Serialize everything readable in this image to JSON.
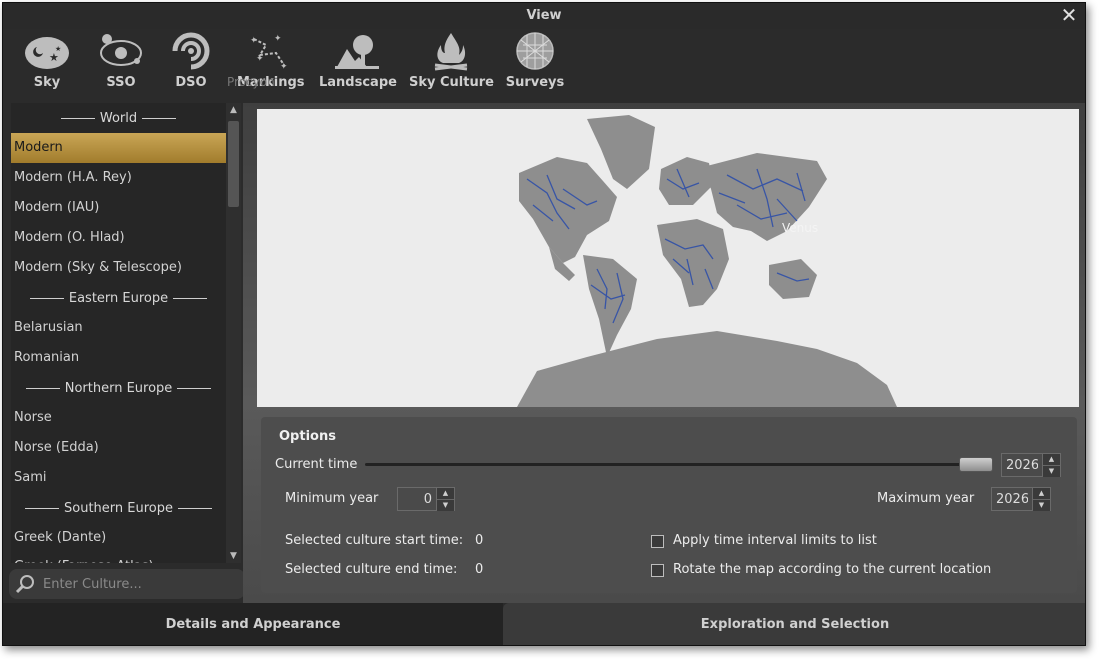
{
  "window": {
    "title": "View"
  },
  "toolbar": {
    "tabs": [
      {
        "label": "Sky",
        "icon": "sky-icon"
      },
      {
        "label": "SSO",
        "icon": "sso-icon"
      },
      {
        "label": "DSO",
        "icon": "dso-icon"
      },
      {
        "label": "Markings",
        "icon": "markings-icon"
      },
      {
        "label": "Landscape",
        "icon": "landscape-icon"
      },
      {
        "label": "Sky Culture",
        "icon": "sky-culture-icon"
      },
      {
        "label": "Surveys",
        "icon": "surveys-icon"
      }
    ],
    "ghost": "Procyon"
  },
  "cultures": {
    "headers": {
      "world": "World",
      "eastern": "Eastern Europe",
      "northern": "Northern Europe",
      "southern": "Southern Europe"
    },
    "items": {
      "modern": "Modern",
      "rey": "Modern (H.A. Rey)",
      "iau": "Modern (IAU)",
      "hlad": "Modern (O. Hlad)",
      "skytel": "Modern (Sky & Telescope)",
      "belarusian": "Belarusian",
      "romanian": "Romanian",
      "norse": "Norse",
      "edda": "Norse (Edda)",
      "sami": "Sami",
      "dante": "Greek (Dante)",
      "clipped": "Greek (Farnese Atlas)"
    }
  },
  "search": {
    "placeholder": "Enter Culture..."
  },
  "map": {
    "overlay_label": "Venus"
  },
  "options": {
    "title": "Options",
    "current_time_label": "Current time",
    "current_time_value": "2026",
    "min_year_label": "Minimum year",
    "min_year_value": "0",
    "max_year_label": "Maximum year",
    "max_year_value": "2026",
    "start_time_label": "Selected culture start time:",
    "start_time_value": "0",
    "end_time_label": "Selected culture end time:",
    "end_time_value": "0",
    "apply_limits_label": "Apply time interval limits to list",
    "rotate_map_label": "Rotate the map according to the current location"
  },
  "bottom_tabs": {
    "details": "Details and Appearance",
    "exploration": "Exploration and Selection"
  },
  "colors": {
    "selected_gradient_top": "#c9a656",
    "selected_gradient_bottom": "#a17c2c",
    "land": "#8e8e8e",
    "rivers": "#2f4fa8",
    "ocean": "#ececec"
  }
}
